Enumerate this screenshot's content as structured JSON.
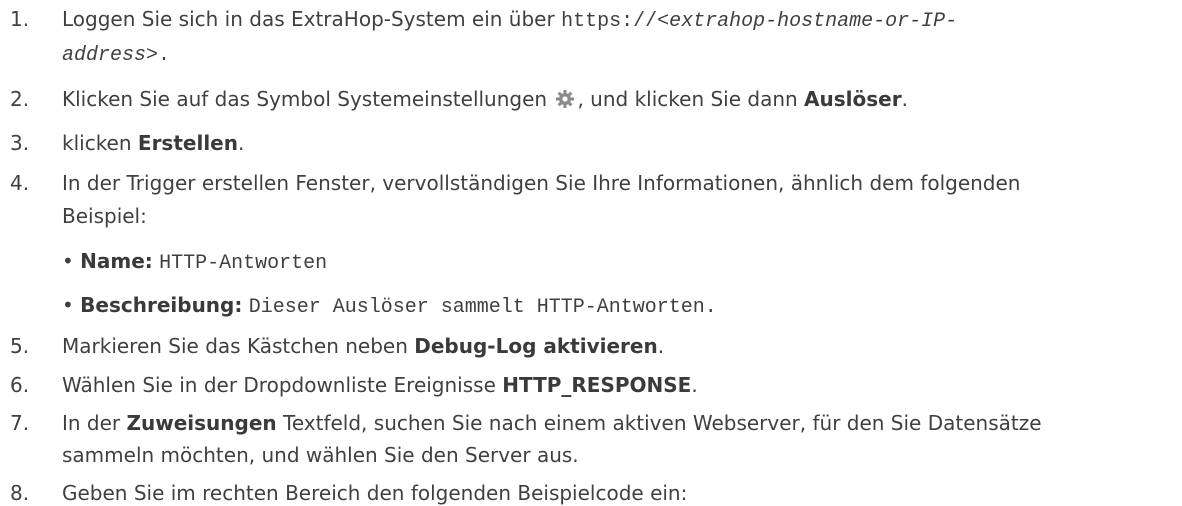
{
  "steps": [
    {
      "num": "1.",
      "a": "Loggen Sie sich in das ExtraHop-System ein über ",
      "code": "https://",
      "code_ital": "<extrahop-hostname-or-IP-",
      "line2_ital": "address",
      "line2_tail": ">."
    },
    {
      "num": "2.",
      "a": "Klicken Sie auf das Symbol Systemeinstellungen ",
      "b": ", und klicken Sie dann ",
      "bold": "Auslöser",
      "c": "."
    },
    {
      "num": "3.",
      "a": "klicken ",
      "bold": "Erstellen",
      "c": "."
    },
    {
      "num": "4.",
      "a": "In der Trigger erstellen Fenster, vervollständigen Sie Ihre Informationen, ähnlich dem folgenden",
      "line2": "Beispiel:"
    },
    {
      "num": "5.",
      "a": "Markieren Sie das Kästchen neben ",
      "bold": "Debug-Log aktivieren",
      "c": "."
    },
    {
      "num": "6.",
      "a": "Wählen Sie in der Dropdownliste Ereignisse ",
      "bold": "HTTP_RESPONSE",
      "c": "."
    },
    {
      "num": "7.",
      "a": "In der ",
      "bold": "Zuweisungen",
      "c": " Textfeld, suchen Sie nach einem aktiven Webserver, für den Sie Datensätze",
      "line2": "sammeln möchten, und wählen Sie den Server aus."
    },
    {
      "num": "8.",
      "a": "Geben Sie im rechten Bereich den folgenden Beispielcode ein:"
    }
  ],
  "bullets": [
    {
      "marker": "•",
      "label": "Name:",
      "value": "HTTP-Antworten"
    },
    {
      "marker": "•",
      "label": "Beschreibung:",
      "value": "Dieser Auslöser sammelt HTTP-Antworten."
    }
  ],
  "icons": {
    "settings": "gear-icon",
    "gear_color": "#8a8a8a"
  }
}
